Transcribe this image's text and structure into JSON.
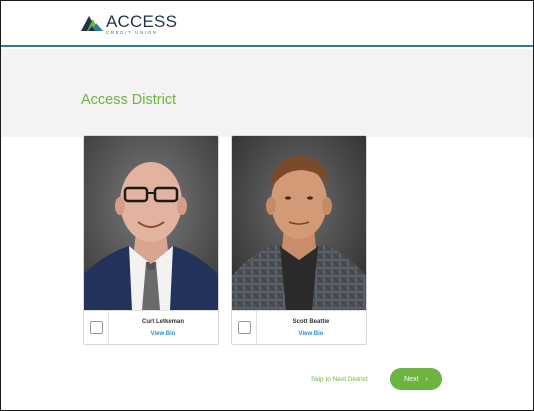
{
  "brand": {
    "name": "ACCESS",
    "tagline": "CREDIT UNION",
    "colors": {
      "primary_green": "#6cb33f",
      "navy": "#1f3547",
      "teal": "#2f7d92",
      "link_blue": "#2e8fc4"
    }
  },
  "page": {
    "title": "Access District"
  },
  "candidates": [
    {
      "name": "Curt Letkeman",
      "bio_link": "View Bio",
      "selected": false
    },
    {
      "name": "Scott Beattie",
      "bio_link": "View Bio",
      "selected": false
    }
  ],
  "actions": {
    "skip_label": "Skip to Next District",
    "next_label": "Next",
    "next_icon": "chevron-right-icon"
  }
}
